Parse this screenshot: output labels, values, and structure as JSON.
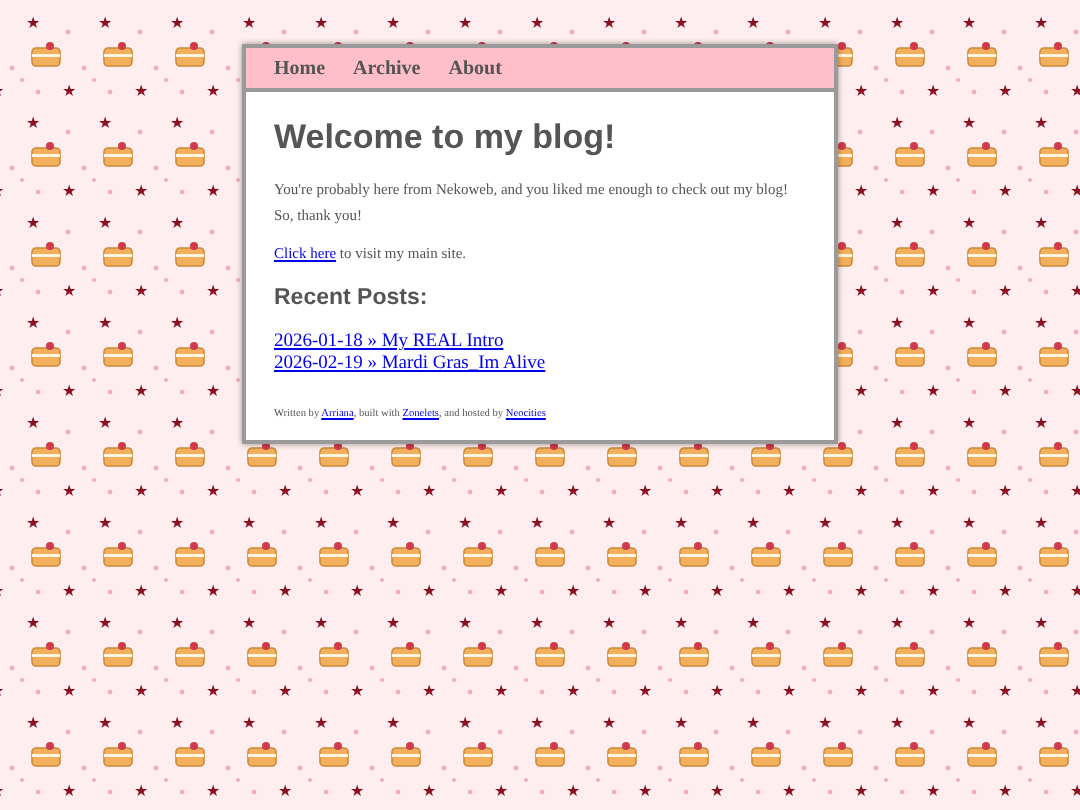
{
  "nav": {
    "items": [
      {
        "label": "Home"
      },
      {
        "label": "Archive"
      },
      {
        "label": "About"
      }
    ]
  },
  "title": "Welcome to my blog!",
  "intro": "You're probably here from Nekoweb, and you liked me enough to check out my blog! So, thank you!",
  "visit": [
    {
      "kind": "link",
      "text": "Click here"
    },
    {
      "kind": "text",
      "text": " to visit my main site."
    }
  ],
  "recent": {
    "heading": "Recent Posts:",
    "posts": [
      "2026-01-18 » My REAL Intro",
      "2026-02-19 » Mardi Gras_Im Alive"
    ]
  },
  "footer": [
    {
      "kind": "text",
      "text": "Written by "
    },
    {
      "kind": "link",
      "text": "Arriana"
    },
    {
      "kind": "text",
      "text": ", built with "
    },
    {
      "kind": "link",
      "text": "Zonelets"
    },
    {
      "kind": "text",
      "text": ", and hosted by "
    },
    {
      "kind": "link",
      "text": "Neocities"
    }
  ]
}
